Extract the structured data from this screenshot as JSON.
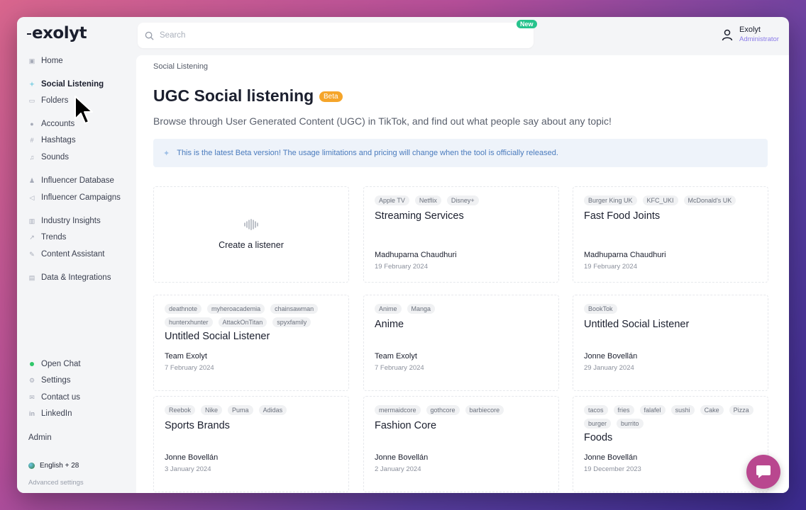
{
  "brand": {
    "logo": "exolyt"
  },
  "sidebar": {
    "items": [
      {
        "label": "Home",
        "icon": "home-icon"
      },
      {
        "label": "Social Listening",
        "icon": "sparkle-icon",
        "active": true
      },
      {
        "label": "Folders",
        "icon": "folder-icon"
      },
      {
        "label": "Accounts",
        "icon": "user-icon"
      },
      {
        "label": "Hashtags",
        "icon": "hashtag-icon"
      },
      {
        "label": "Sounds",
        "icon": "music-icon"
      },
      {
        "label": "Influencer Database",
        "icon": "person-icon"
      },
      {
        "label": "Influencer Campaigns",
        "icon": "megaphone-icon"
      },
      {
        "label": "Industry Insights",
        "icon": "bar-chart-icon"
      },
      {
        "label": "Trends",
        "icon": "trend-icon"
      },
      {
        "label": "Content Assistant",
        "icon": "wand-icon"
      },
      {
        "label": "Data & Integrations",
        "icon": "database-icon"
      }
    ],
    "bottom_items": [
      {
        "label": "Open Chat",
        "icon": "online-dot-icon"
      },
      {
        "label": "Settings",
        "icon": "gear-icon"
      },
      {
        "label": "Contact us",
        "icon": "chat-icon"
      },
      {
        "label": "LinkedIn",
        "icon": "linkedin-icon"
      }
    ],
    "admin_label": "Admin",
    "language": "English + 28",
    "advanced": "Advanced settings"
  },
  "header": {
    "search_placeholder": "Search",
    "new_badge": "New",
    "user_name": "Exolyt",
    "user_role": "Administrator"
  },
  "main": {
    "breadcrumb": "Social Listening",
    "title": "UGC Social listening",
    "beta_badge": "Beta",
    "subtitle": "Browse through User Generated Content (UGC) in TikTok, and find out what people say about any topic!",
    "notice": "This is the latest Beta version! The usage limitations and pricing will change when the tool is officially released.",
    "create_label": "Create a listener",
    "cards": [
      {
        "tags": [
          "Apple TV",
          "Netflix",
          "Disney+"
        ],
        "title": "Streaming Services",
        "owner": "Madhuparna Chaudhuri",
        "date": "19 February 2024"
      },
      {
        "tags": [
          "Burger King UK",
          "KFC_UKI",
          "McDonald's UK"
        ],
        "title": "Fast Food Joints",
        "owner": "Madhuparna Chaudhuri",
        "date": "19 February 2024"
      },
      {
        "tags": [
          "deathnote",
          "myheroacademia",
          "chainsawman",
          "hunterxhunter",
          "AttackOnTitan",
          "spyxfamily"
        ],
        "title": "Untitled Social Listener",
        "owner": "Team Exolyt",
        "date": "7 February 2024"
      },
      {
        "tags": [
          "Anime",
          "Manga"
        ],
        "title": "Anime",
        "owner": "Team Exolyt",
        "date": "7 February 2024"
      },
      {
        "tags": [
          "BookTok"
        ],
        "title": "Untitled Social Listener",
        "owner": "Jonne Bovellán",
        "date": "29 January 2024"
      },
      {
        "tags": [
          "Reebok",
          "Nike",
          "Puma",
          "Adidas"
        ],
        "title": "Sports Brands",
        "owner": "Jonne Bovellán",
        "date": "3 January 2024"
      },
      {
        "tags": [
          "mermaidcore",
          "gothcore",
          "barbiecore"
        ],
        "title": "Fashion Core",
        "owner": "Jonne Bovellán",
        "date": "2 January 2024"
      },
      {
        "tags": [
          "tacos",
          "fries",
          "falafel",
          "sushi",
          "Cake",
          "Pizza",
          "burger",
          "burrito"
        ],
        "title": "Foods",
        "owner": "Jonne Bovellán",
        "date": "19 December 2023"
      }
    ]
  },
  "colors": {
    "accent": "#b9478f",
    "beta": "#f5a52a",
    "new": "#27c38d",
    "notice_text": "#4a7bbd",
    "role": "#8a7be8"
  }
}
